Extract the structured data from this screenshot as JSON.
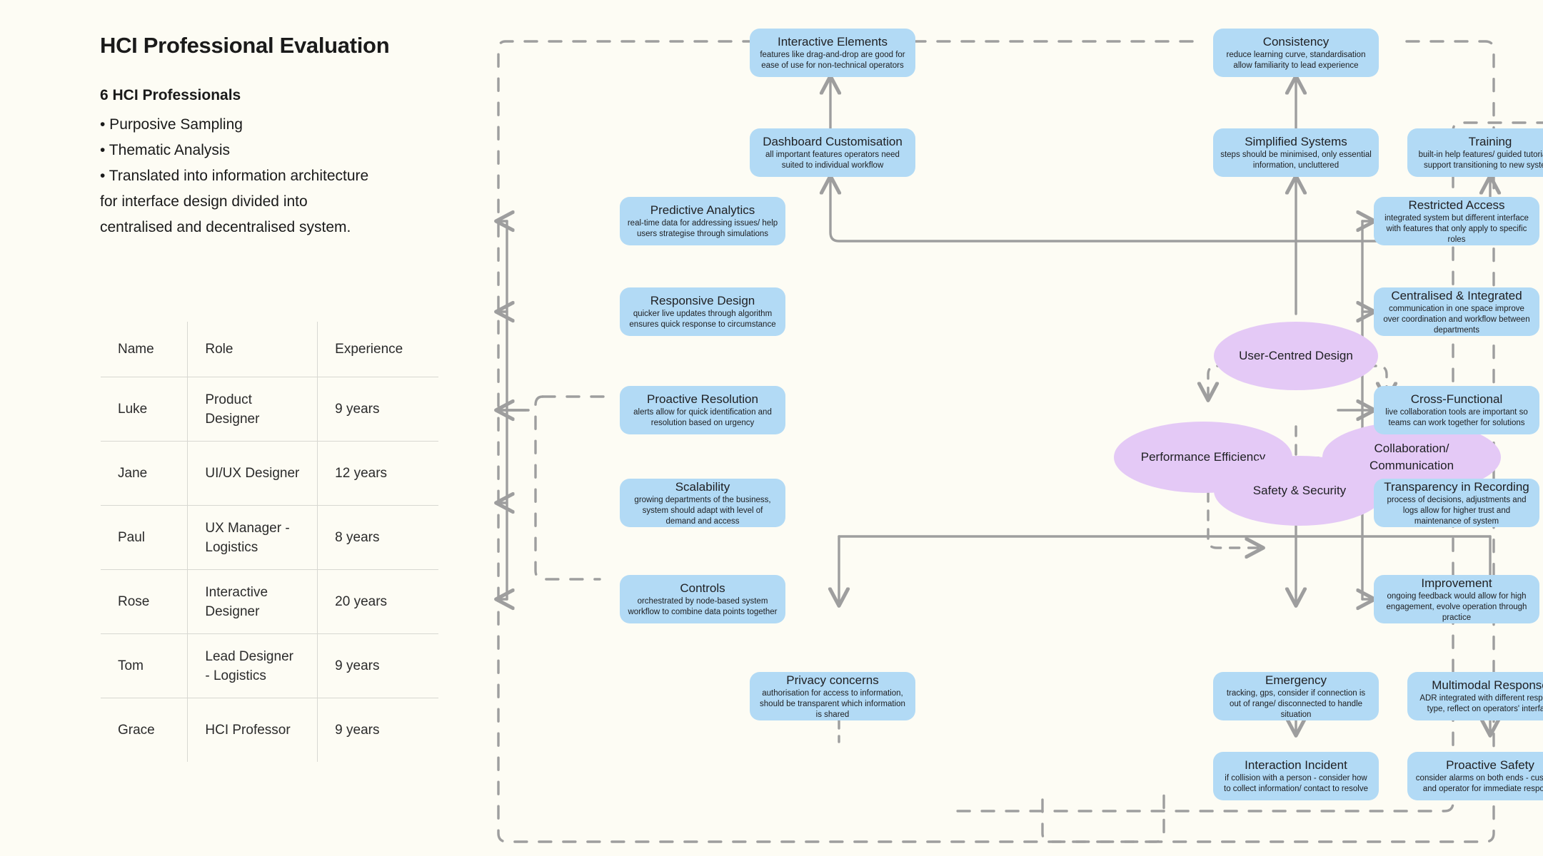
{
  "left": {
    "title": "HCI Professional Evaluation",
    "subhead": "6 HCI Professionals",
    "bullets": [
      "• Purposive Sampling",
      "• Thematic Analysis",
      "• Translated into information architecture",
      "for interface design divided into",
      "centralised and decentralised system."
    ],
    "table": {
      "headers": [
        "Name",
        "Role",
        "Experience"
      ],
      "rows": [
        [
          "Luke",
          "Product Designer",
          "9 years"
        ],
        [
          "Jane",
          "UI/UX Designer",
          "12 years"
        ],
        [
          "Paul",
          "UX Manager - Logistics",
          "8 years"
        ],
        [
          "Rose",
          "Interactive Designer",
          "20 years"
        ],
        [
          "Tom",
          "Lead Designer - Logistics",
          "9 years"
        ],
        [
          "Grace",
          "HCI Professor",
          "9 years"
        ]
      ]
    }
  },
  "colors": {
    "background": "#fdfcf4",
    "node_blue": "#b2daf5",
    "ellipse_purple": "#e4c9f6",
    "wire_grey": "#9e9e9e",
    "text_dark": "#202124"
  },
  "diagram": {
    "hubs": [
      {
        "id": "user-centred-design",
        "label": "User-Centred Design"
      },
      {
        "id": "performance-efficiency",
        "label": "Performance Efficiency"
      },
      {
        "id": "collaboration-communication",
        "label": "Collaboration/ Communication",
        "line1": "Collaboration/",
        "line2": "Communication"
      },
      {
        "id": "safety-security",
        "label": "Safety & Security"
      }
    ],
    "nodes": [
      {
        "id": "interactive-elements",
        "title": "Interactive Elements",
        "desc": "features like drag-and-drop are good for ease of use for non-technical operators"
      },
      {
        "id": "consistency",
        "title": "Consistency",
        "desc": "reduce learning curve, standardisation allow familiarity to lead experience"
      },
      {
        "id": "dashboard-customisation",
        "title": "Dashboard Customisation",
        "desc": "all important features operators need suited to individual workflow"
      },
      {
        "id": "simplified-systems",
        "title": "Simplified Systems",
        "desc": "steps should be minimised, only essential information, uncluttered"
      },
      {
        "id": "training",
        "title": "Training",
        "desc": "built-in help features/ guided tutorials to support transitioning to new systems"
      },
      {
        "id": "predictive-analytics",
        "title": "Predictive Analytics",
        "desc": "real-time data for addressing issues/ help users strategise through simulations"
      },
      {
        "id": "responsive-design",
        "title": "Responsive Design",
        "desc": "quicker live updates through algorithm ensures quick response to circumstance"
      },
      {
        "id": "proactive-resolution",
        "title": "Proactive Resolution",
        "desc": "alerts allow for quick identification and resolution based on urgency"
      },
      {
        "id": "scalability",
        "title": "Scalability",
        "desc": "growing departments of the business, system should adapt with level of demand and access"
      },
      {
        "id": "controls",
        "title": "Controls",
        "desc": "orchestrated by node-based system workflow to combine data points together"
      },
      {
        "id": "restricted-access",
        "title": "Restricted Access",
        "desc": "integrated system but different interface with features that only apply to specific roles"
      },
      {
        "id": "centralised-integrated",
        "title": "Centralised & Integrated",
        "desc": "communication in one space improve over coordination and workflow between departments"
      },
      {
        "id": "cross-functional",
        "title": "Cross-Functional",
        "desc": "live collaboration tools are important so teams can work together for solutions"
      },
      {
        "id": "transparency-in-recording",
        "title": "Transparency in Recording",
        "desc": "process of decisions, adjustments and logs allow for higher trust and maintenance of system"
      },
      {
        "id": "improvement",
        "title": "Improvement",
        "desc": "ongoing feedback would allow for high engagement, evolve operation through practice"
      },
      {
        "id": "privacy-concerns",
        "title": "Privacy concerns",
        "desc": "authorisation for access to information, should be transparent which information is shared"
      },
      {
        "id": "emergency",
        "title": "Emergency",
        "desc": "tracking, gps, consider if connection is out of range/ disconnected to handle situation"
      },
      {
        "id": "multimodal-response",
        "title": "Multimodal Response",
        "desc": "ADR integrated with different response type, reflect on operators' interface"
      },
      {
        "id": "interaction-incident",
        "title": "Interaction Incident",
        "desc": "if collision with a person - consider how to collect information/ contact to resolve"
      },
      {
        "id": "proactive-safety",
        "title": "Proactive Safety",
        "desc": "consider alarms on both ends - customer and operator for immediate response"
      }
    ]
  }
}
